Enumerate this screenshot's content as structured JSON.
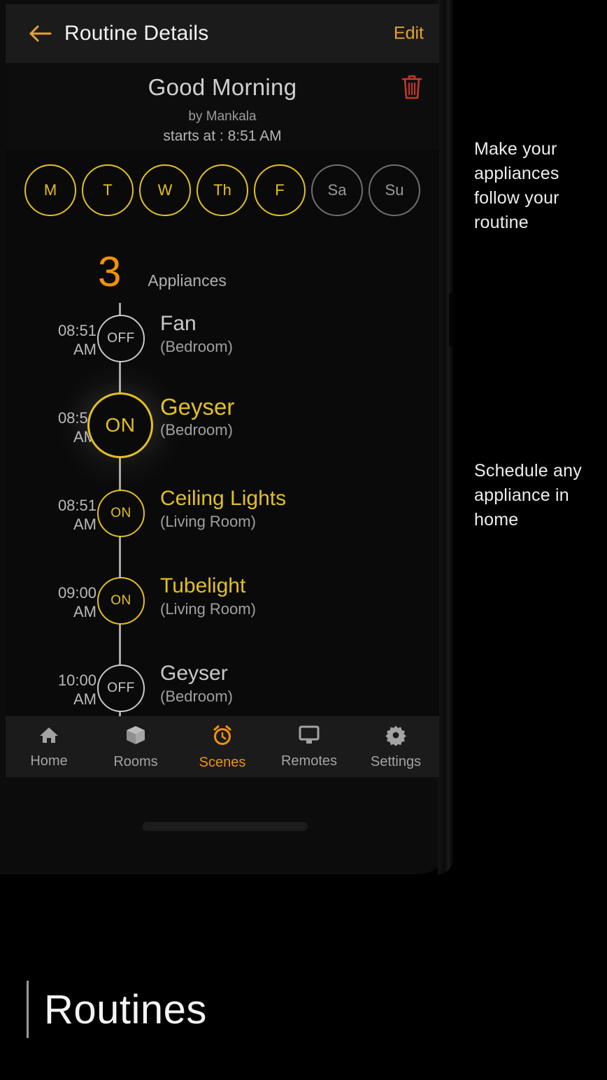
{
  "appbar": {
    "back_icon": "arrow-left-icon",
    "title": "Routine Details",
    "edit_label": "Edit",
    "accent": "#e8a033"
  },
  "routine": {
    "name": "Good Morning",
    "author": "by Mankala",
    "starts_at": "starts at : 8:51 AM",
    "delete_icon": "trash-icon",
    "delete_color": "#c0392b"
  },
  "days": [
    {
      "label": "M",
      "active": true
    },
    {
      "label": "T",
      "active": true
    },
    {
      "label": "W",
      "active": true
    },
    {
      "label": "Th",
      "active": true
    },
    {
      "label": "F",
      "active": true
    },
    {
      "label": "Sa",
      "active": false
    },
    {
      "label": "Su",
      "active": false
    }
  ],
  "summary": {
    "count": "3",
    "count_label": "Appliances",
    "count_color": "#f0920a"
  },
  "timeline": [
    {
      "time_hm": "08:51",
      "time_ampm": "AM",
      "state": "OFF",
      "name": "Fan",
      "room": "(Bedroom)",
      "on": false,
      "highlight": false
    },
    {
      "time_hm": "08:51",
      "time_ampm": "AM",
      "state": "ON",
      "name": "Geyser",
      "room": "(Bedroom)",
      "on": true,
      "highlight": true
    },
    {
      "time_hm": "08:51",
      "time_ampm": "AM",
      "state": "ON",
      "name": "Ceiling Lights",
      "room": "(Living Room)",
      "on": true,
      "highlight": false
    },
    {
      "time_hm": "09:00",
      "time_ampm": "AM",
      "state": "ON",
      "name": "Tubelight",
      "room": "(Living Room)",
      "on": true,
      "highlight": false
    },
    {
      "time_hm": "10:00",
      "time_ampm": "AM",
      "state": "OFF",
      "name": "Geyser",
      "room": "(Bedroom)",
      "on": false,
      "highlight": false
    }
  ],
  "bottom_nav": [
    {
      "label": "Home",
      "icon": "home-icon",
      "active": false
    },
    {
      "label": "Rooms",
      "icon": "cube-icon",
      "active": false
    },
    {
      "label": "Scenes",
      "icon": "alarm-icon",
      "active": true
    },
    {
      "label": "Remotes",
      "icon": "monitor-icon",
      "active": false
    },
    {
      "label": "Settings",
      "icon": "gear-icon",
      "active": false
    }
  ],
  "captions": {
    "one": "Make your appliances follow your routine",
    "two": "Schedule any appliance in home"
  },
  "footer": {
    "title": "Routines"
  }
}
